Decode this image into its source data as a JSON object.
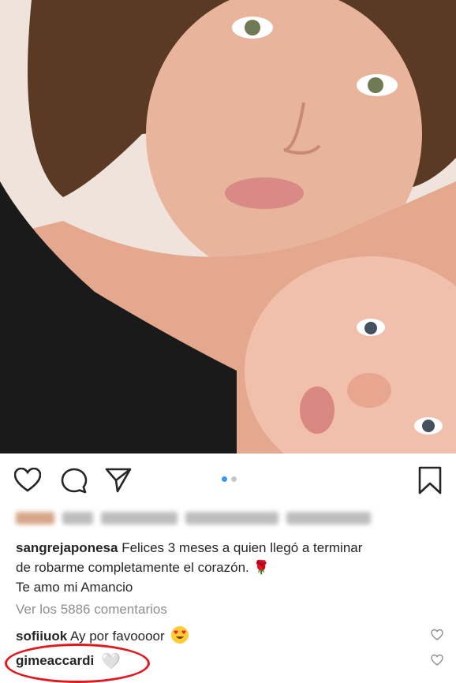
{
  "post": {
    "caption_user": "sangrejaponesa",
    "caption_line1": "Felices 3 meses a quien llegó a terminar",
    "caption_line2": "de robarme completamente el corazón.",
    "caption_line3": "Te amo mi Amancio",
    "rose_emoji": "🌹",
    "view_comments": "Ver los 5886 comentarios"
  },
  "comments": [
    {
      "user": "sofiiuok",
      "text": "Ay por favoooor"
    },
    {
      "user": "gimeaccardi",
      "text": "🤍"
    }
  ],
  "carousel": {
    "count": 2,
    "active": 0
  },
  "icons": [
    "heart-icon",
    "comment-icon",
    "share-icon",
    "bookmark-icon"
  ],
  "colors": {
    "accent": "#3897f0",
    "highlight": "#e0181f"
  }
}
